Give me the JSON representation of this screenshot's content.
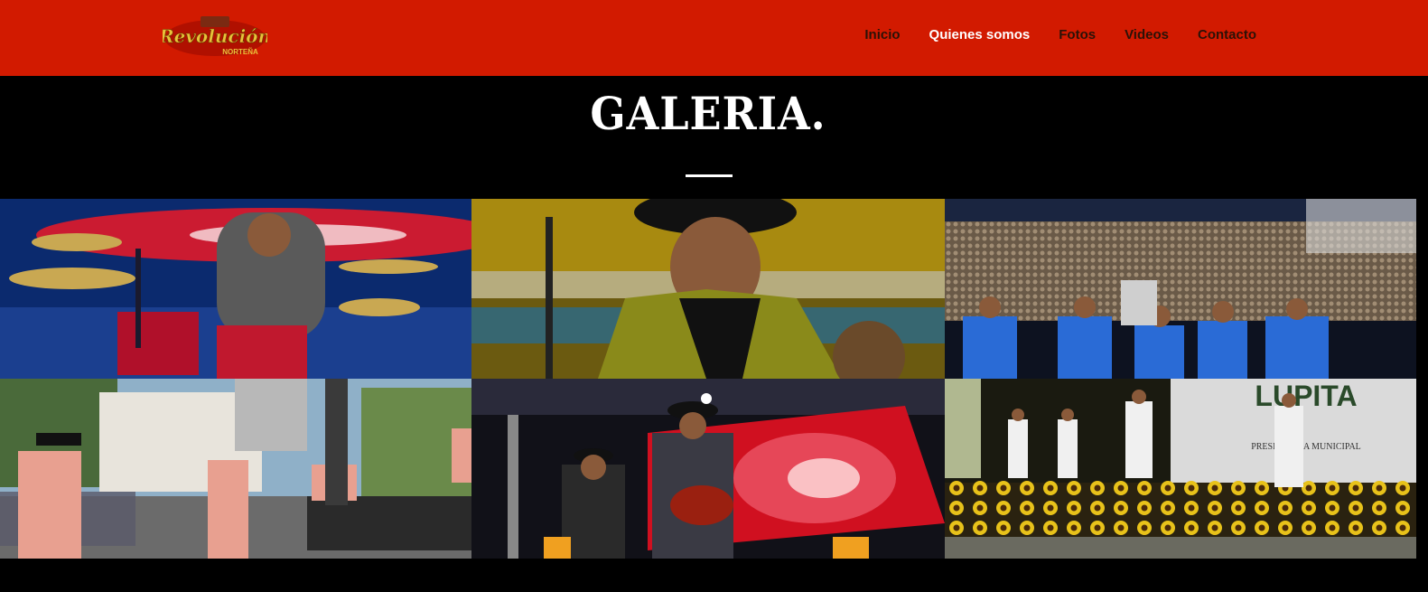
{
  "header": {
    "logo_text": "Revolución Norteña",
    "nav": [
      {
        "label": "Inicio",
        "active": false
      },
      {
        "label": "Quienes somos",
        "active": true
      },
      {
        "label": "Fotos",
        "active": false
      },
      {
        "label": "Videos",
        "active": false
      },
      {
        "label": "Contacto",
        "active": false
      }
    ],
    "colors": {
      "header_bg": "#d21a00",
      "nav_text": "#2b1207",
      "nav_active": "#ffffff"
    }
  },
  "main": {
    "title": "GALERIA."
  },
  "gallery": {
    "photos": [
      {
        "name": "drummer-on-stage-photo"
      },
      {
        "name": "singer-with-microphone-photo"
      },
      {
        "name": "band-with-crowd-photo"
      },
      {
        "name": "outdoor-stage-band-photo"
      },
      {
        "name": "saxophone-and-guitar-photo"
      },
      {
        "name": "sunflower-stage-band-photo"
      }
    ]
  }
}
